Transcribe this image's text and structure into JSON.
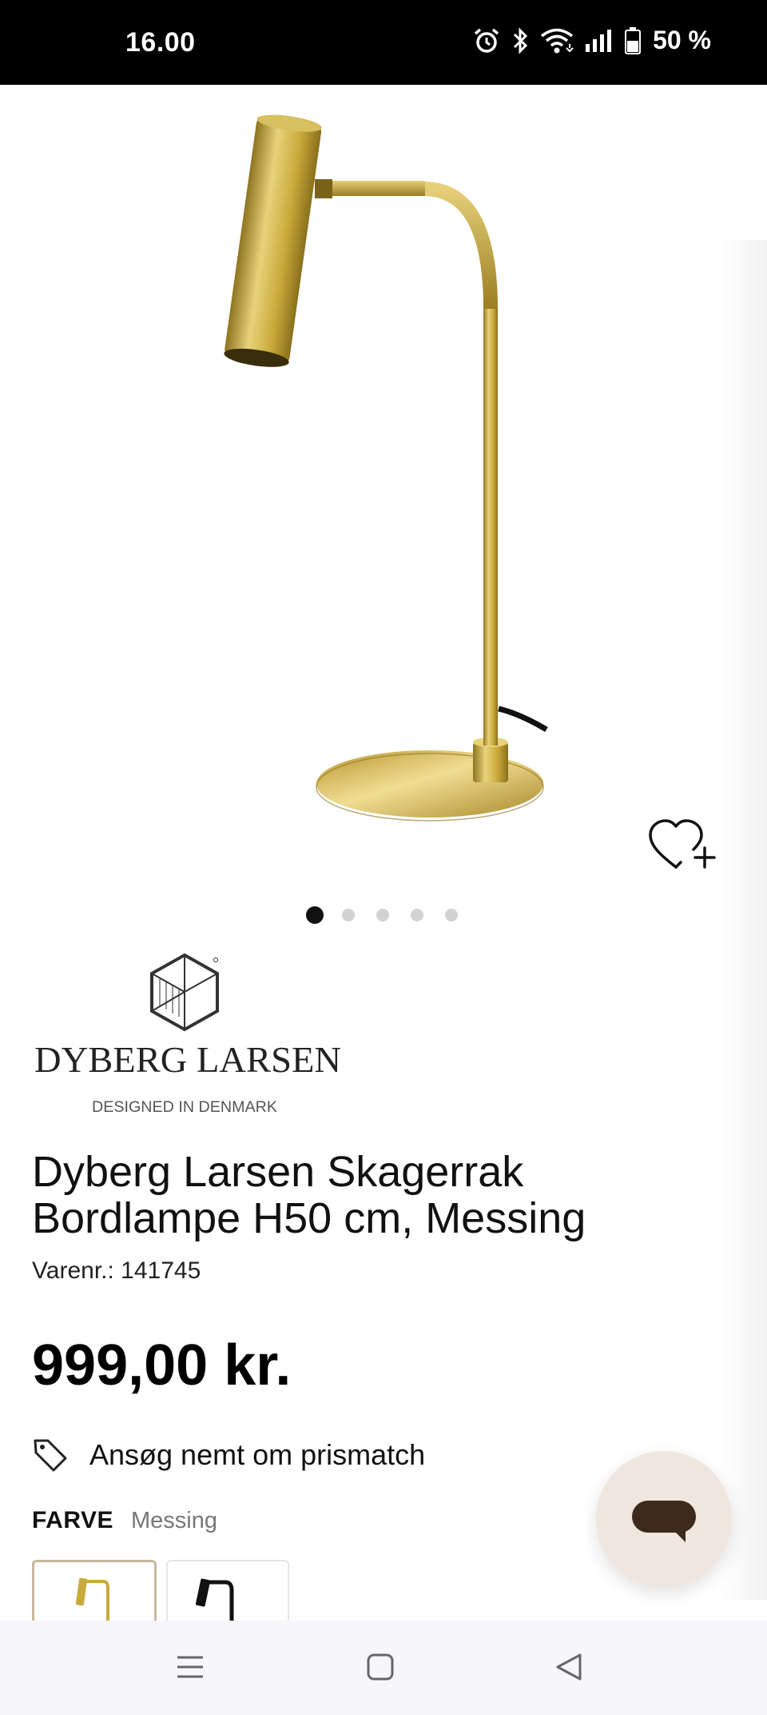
{
  "status_bar": {
    "time": "16.00",
    "icons": [
      "alarm-icon",
      "bluetooth-icon",
      "wifi-icon",
      "signal-icon",
      "battery-icon"
    ],
    "battery": "50 %"
  },
  "gallery": {
    "image_alt": "Brass table lamp",
    "current_index": 1,
    "total": 5
  },
  "brand": {
    "name": "DYBERG LARSEN",
    "tagline": "DESIGNED IN DENMARK"
  },
  "product": {
    "title": "Dyberg Larsen Skagerrak Bordlampe H50 cm, Messing",
    "sku": "Varenr.: 141745",
    "price": "999,00 kr.",
    "price_match": "Ansøg nemt om prismatch"
  },
  "color": {
    "label": "FARVE",
    "value": "Messing",
    "options": [
      "Messing",
      "Sort"
    ],
    "selected": "Messing"
  },
  "colors": {
    "brass": "#c9a93a",
    "chat_bg": "#efe6de",
    "chat_icon": "#3d2a1d",
    "swatch_selected_border": "#c9b79b"
  },
  "nav": {
    "items": [
      "menu-icon",
      "home-icon",
      "back-icon"
    ]
  }
}
